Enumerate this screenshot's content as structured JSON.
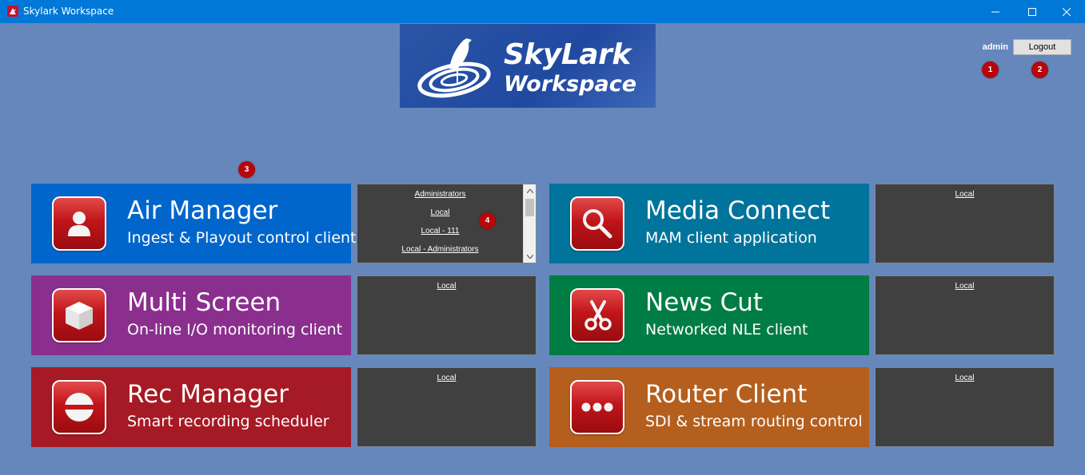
{
  "window": {
    "title": "Skylark Workspace",
    "icon": "skylark-app-icon",
    "controls": [
      "minimize-icon",
      "maximize-icon",
      "close-icon"
    ]
  },
  "logo": {
    "line1": "SkyLark",
    "line2": "Workspace"
  },
  "user": {
    "username": "admin",
    "logout_label": "Logout"
  },
  "markers": [
    "1",
    "2",
    "3",
    "4"
  ],
  "colors": {
    "background": "#6587bb",
    "titlebar": "#0078d7",
    "air_manager": "#0066cc",
    "multi_screen": "#8b2f8e",
    "rec_manager": "#a61a25",
    "media_connect": "#00749b",
    "news_cut": "#007d44",
    "router_client": "#b45f1e",
    "panel": "#404040",
    "marker": "#b5070c"
  },
  "apps": [
    {
      "id": "air-manager",
      "title": "Air Manager",
      "subtitle": "Ingest & Playout control client",
      "icon": "user-icon",
      "profiles": [
        "Administrators",
        "Local",
        "Local - 111",
        "Local - Administrators"
      ]
    },
    {
      "id": "media-connect",
      "title": "Media Connect",
      "subtitle": "MAM client application",
      "icon": "magnifier-icon",
      "profiles": [
        "Local"
      ]
    },
    {
      "id": "multi-screen",
      "title": "Multi Screen",
      "subtitle": "On-line I/O monitoring client",
      "icon": "cube-icon",
      "profiles": [
        "Local"
      ]
    },
    {
      "id": "news-cut",
      "title": "News Cut",
      "subtitle": "Networked NLE client",
      "icon": "scissors-icon",
      "profiles": [
        "Local"
      ]
    },
    {
      "id": "rec-manager",
      "title": "Rec Manager",
      "subtitle": "Smart recording scheduler",
      "icon": "record-icon",
      "profiles": [
        "Local"
      ]
    },
    {
      "id": "router-client",
      "title": "Router Client",
      "subtitle": "SDI & stream routing control",
      "icon": "dots-icon",
      "profiles": [
        "Local"
      ]
    }
  ]
}
